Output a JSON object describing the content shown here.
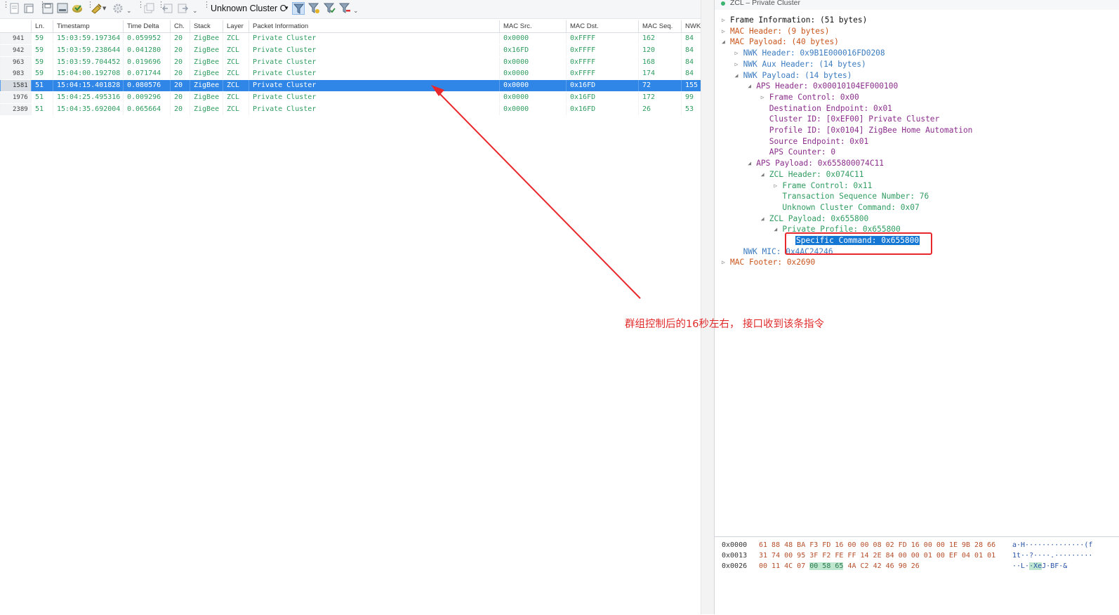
{
  "toolbar": {
    "cluster_filter": "Unknown Cluster C",
    "icons": [
      "new-capture-icon",
      "open-file-icon",
      "save-icon",
      "print-icon",
      "export-icon",
      "decoder-icon",
      "settings-icon",
      "copy-icon",
      "back-icon",
      "forward-icon",
      "filter-add-icon",
      "filter-edit-icon",
      "filter-apply-icon",
      "filter-clear-icon"
    ]
  },
  "table": {
    "columns": [
      "Ln.",
      "Timestamp",
      "Time Delta",
      "Ch.",
      "Stack",
      "Layer",
      "Packet Information",
      "MAC Src.",
      "MAC Dst.",
      "MAC Seq.",
      "NWK"
    ],
    "rows": [
      {
        "no": "941",
        "ln": "59",
        "ts": "15:03:59.197364",
        "delta": "0.059952",
        "ch": "20",
        "stack": "ZigBee",
        "layer": "ZCL",
        "info": "Private Cluster",
        "src": "0x0000",
        "dst": "0xFFFF",
        "seq": "162",
        "nwk": "84"
      },
      {
        "no": "942",
        "ln": "59",
        "ts": "15:03:59.238644",
        "delta": "0.041280",
        "ch": "20",
        "stack": "ZigBee",
        "layer": "ZCL",
        "info": "Private Cluster",
        "src": "0x16FD",
        "dst": "0xFFFF",
        "seq": "120",
        "nwk": "84"
      },
      {
        "no": "963",
        "ln": "59",
        "ts": "15:03:59.704452",
        "delta": "0.019696",
        "ch": "20",
        "stack": "ZigBee",
        "layer": "ZCL",
        "info": "Private Cluster",
        "src": "0x0000",
        "dst": "0xFFFF",
        "seq": "168",
        "nwk": "84"
      },
      {
        "no": "983",
        "ln": "59",
        "ts": "15:04:00.192708",
        "delta": "0.071744",
        "ch": "20",
        "stack": "ZigBee",
        "layer": "ZCL",
        "info": "Private Cluster",
        "src": "0x0000",
        "dst": "0xFFFF",
        "seq": "174",
        "nwk": "84"
      },
      {
        "no": "1581",
        "ln": "51",
        "ts": "15:04:15.401828",
        "delta": "0.080576",
        "ch": "20",
        "stack": "ZigBee",
        "layer": "ZCL",
        "info": "Private Cluster",
        "src": "0x0000",
        "dst": "0x16FD",
        "seq": "72",
        "nwk": "155",
        "selected": true
      },
      {
        "no": "1976",
        "ln": "51",
        "ts": "15:04:25.495316",
        "delta": "0.009296",
        "ch": "20",
        "stack": "ZigBee",
        "layer": "ZCL",
        "info": "Private Cluster",
        "src": "0x0000",
        "dst": "0x16FD",
        "seq": "172",
        "nwk": "99"
      },
      {
        "no": "2389",
        "ln": "51",
        "ts": "15:04:35.692004",
        "delta": "0.065664",
        "ch": "20",
        "stack": "ZigBee",
        "layer": "ZCL",
        "info": "Private Cluster",
        "src": "0x0000",
        "dst": "0x16FD",
        "seq": "26",
        "nwk": "53"
      }
    ]
  },
  "detail": {
    "title": "ZCL – Private Cluster",
    "tree": [
      {
        "depth": 0,
        "arrow": "right",
        "text": "Frame Information: (51 bytes)",
        "color": "black"
      },
      {
        "depth": 0,
        "arrow": "right",
        "text": "MAC Header: (9 bytes)",
        "color": "orange"
      },
      {
        "depth": 0,
        "arrow": "down",
        "text": "MAC Payload: (40 bytes)",
        "color": "orange"
      },
      {
        "depth": 1,
        "arrow": "right",
        "text": "NWK Header: 0x9B1E000016FD0208",
        "color": "blue"
      },
      {
        "depth": 1,
        "arrow": "right",
        "text": "NWK Aux Header: (14 bytes)",
        "color": "blue"
      },
      {
        "depth": 1,
        "arrow": "down",
        "text": "NWK Payload: (14 bytes)",
        "color": "blue"
      },
      {
        "depth": 2,
        "arrow": "down",
        "text": "APS Header: 0x00010104EF000100",
        "color": "purple"
      },
      {
        "depth": 3,
        "arrow": "right",
        "text": "Frame Control: 0x00",
        "color": "purple"
      },
      {
        "depth": 3,
        "arrow": "",
        "text": "Destination Endpoint: 0x01",
        "color": "purple"
      },
      {
        "depth": 3,
        "arrow": "",
        "text": "Cluster ID: [0xEF00] Private Cluster",
        "color": "purple"
      },
      {
        "depth": 3,
        "arrow": "",
        "text": "Profile ID: [0x0104] ZigBee Home Automation",
        "color": "purple"
      },
      {
        "depth": 3,
        "arrow": "",
        "text": "Source Endpoint: 0x01",
        "color": "purple"
      },
      {
        "depth": 3,
        "arrow": "",
        "text": "APS Counter: 0",
        "color": "purple"
      },
      {
        "depth": 2,
        "arrow": "down",
        "text": "APS Payload: 0x655800074C11",
        "color": "purple"
      },
      {
        "depth": 3,
        "arrow": "down",
        "text": "ZCL Header: 0x074C11",
        "color": "green"
      },
      {
        "depth": 4,
        "arrow": "right",
        "text": "Frame Control: 0x11",
        "color": "green"
      },
      {
        "depth": 4,
        "arrow": "",
        "text": "Transaction Sequence Number: 76",
        "color": "green"
      },
      {
        "depth": 4,
        "arrow": "",
        "text": "Unknown Cluster Command: 0x07",
        "color": "green"
      },
      {
        "depth": 3,
        "arrow": "down",
        "text": "ZCL Payload: 0x655800",
        "color": "green"
      },
      {
        "depth": 4,
        "arrow": "down",
        "text": "Private Profile: 0x655800",
        "color": "green"
      },
      {
        "depth": 5,
        "arrow": "",
        "text": "Specific Command: 0x655800",
        "color": "green",
        "highlight": true
      },
      {
        "depth": 1,
        "arrow": "",
        "text": "NWK MIC: 0x4AC24246",
        "color": "blue"
      },
      {
        "depth": 0,
        "arrow": "right",
        "text": "MAC Footer: 0x2690",
        "color": "orange"
      }
    ]
  },
  "hex": [
    {
      "offset": "0x0000",
      "bytes": "61 88 48 BA F3 FD 16 00 00 08 02 FD 16 00 00 1E 9B 28 66",
      "ascii": "a·H··············(f"
    },
    {
      "offset": "0x0013",
      "bytes": "31 74 00 95 3F F2 FE FF 14 2E 84 00 00 01 00 EF 04 01 01",
      "ascii": "1t··?····.·········"
    },
    {
      "offset": "0x0026",
      "bytes_pre": "00 11 4C 07 ",
      "bytes_hl": "00 58 65",
      "bytes_post": " 4A C2 42 46 90 26",
      "ascii_pre": "··L·",
      "ascii_hl": "·Xe",
      "ascii_post": "J·BF·&"
    }
  ],
  "annotation": {
    "text": "群组控制后的16秒左右， 接口收到该条指令",
    "color": "#e02a2a"
  },
  "colors": {
    "selection": "#2f86e6",
    "green": "#2f9c60",
    "annotation_red": "#e8282c"
  }
}
